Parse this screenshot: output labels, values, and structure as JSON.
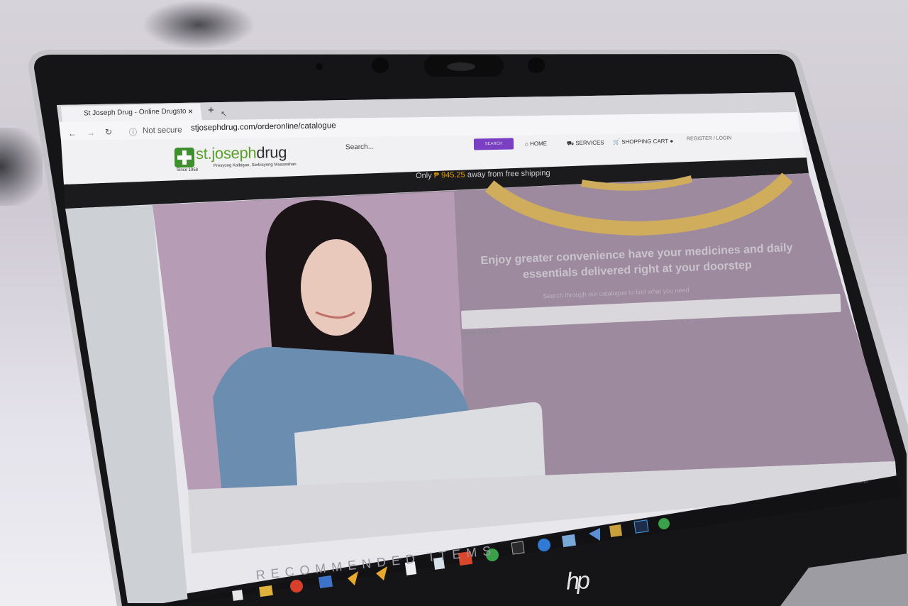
{
  "browser": {
    "tab_title": "St Joseph Drug - Online Drugsto",
    "tab_close": "×",
    "new_tab": "+",
    "security_label": "Not secure",
    "url": "stjosephdrug.com/orderonline/catalogue"
  },
  "site": {
    "logo_part1": "st.joseph",
    "logo_part2": "drug",
    "logo_since": "Since 1958",
    "logo_tagline": "Presyong Kaibigan, Serbisyong Maaasahan",
    "search_placeholder": "Search...",
    "search_button": "SEARCH",
    "nav_home": "HOME",
    "nav_services": "SERVICES",
    "nav_cart": "SHOPPING CART",
    "nav_login": "REGISTER / LOGIN",
    "shipping_prefix": "Only ",
    "shipping_amount": "₱ 945.25",
    "shipping_suffix": " away from free shipping"
  },
  "hero": {
    "headline": "Enjoy greater convenience have your medicines and daily essentials delivered right at your doorstep",
    "subtext": "Search through our catalogue to find what you need",
    "search_placeholder": "Search here..."
  },
  "section_heading": "RECOMMENDED ITEMS",
  "laptop_brand": "hp",
  "colors": {
    "brand_green": "#5aa02c",
    "search_button": "#7a3fc2",
    "shipping_amount": "#e0a000",
    "hero_bg": "#9e8a9f"
  }
}
